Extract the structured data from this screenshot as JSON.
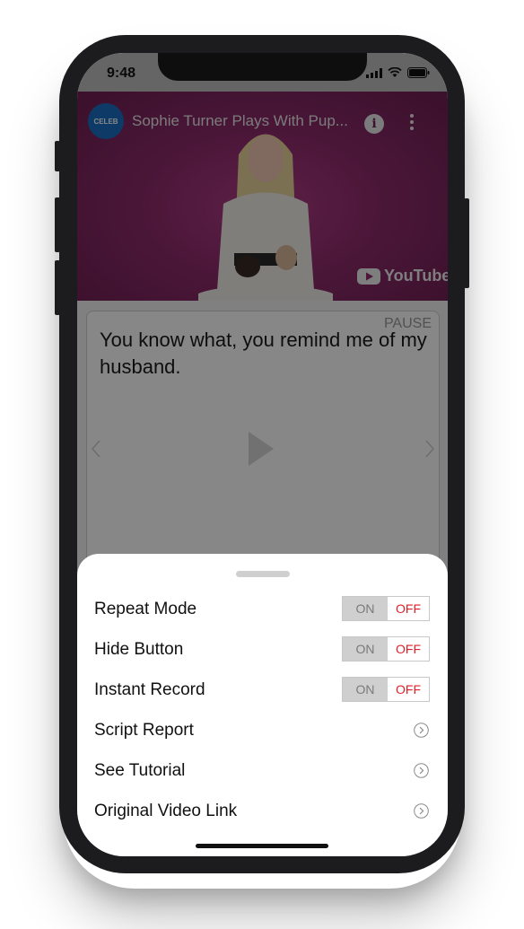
{
  "status_bar": {
    "time": "9:48"
  },
  "video": {
    "channel_logo_text": "CELEB",
    "title": "Sophie Turner Plays With Pup...",
    "info_icon": "info-icon",
    "more_icon": "more-vertical-icon",
    "watermark": "YouTube"
  },
  "script": {
    "pause_label": "PAUSE",
    "text": "You know what, you remind me of my husband."
  },
  "sheet": {
    "toggles": [
      {
        "label": "Repeat Mode",
        "on": "ON",
        "off": "OFF",
        "state": "off"
      },
      {
        "label": "Hide Button",
        "on": "ON",
        "off": "OFF",
        "state": "off"
      },
      {
        "label": "Instant Record",
        "on": "ON",
        "off": "OFF",
        "state": "off"
      }
    ],
    "links": [
      {
        "label": "Script Report"
      },
      {
        "label": "See Tutorial"
      },
      {
        "label": "Original Video Link"
      }
    ]
  },
  "colors": {
    "off_active": "#e0202a",
    "video_bg": "#8e2b6c"
  }
}
